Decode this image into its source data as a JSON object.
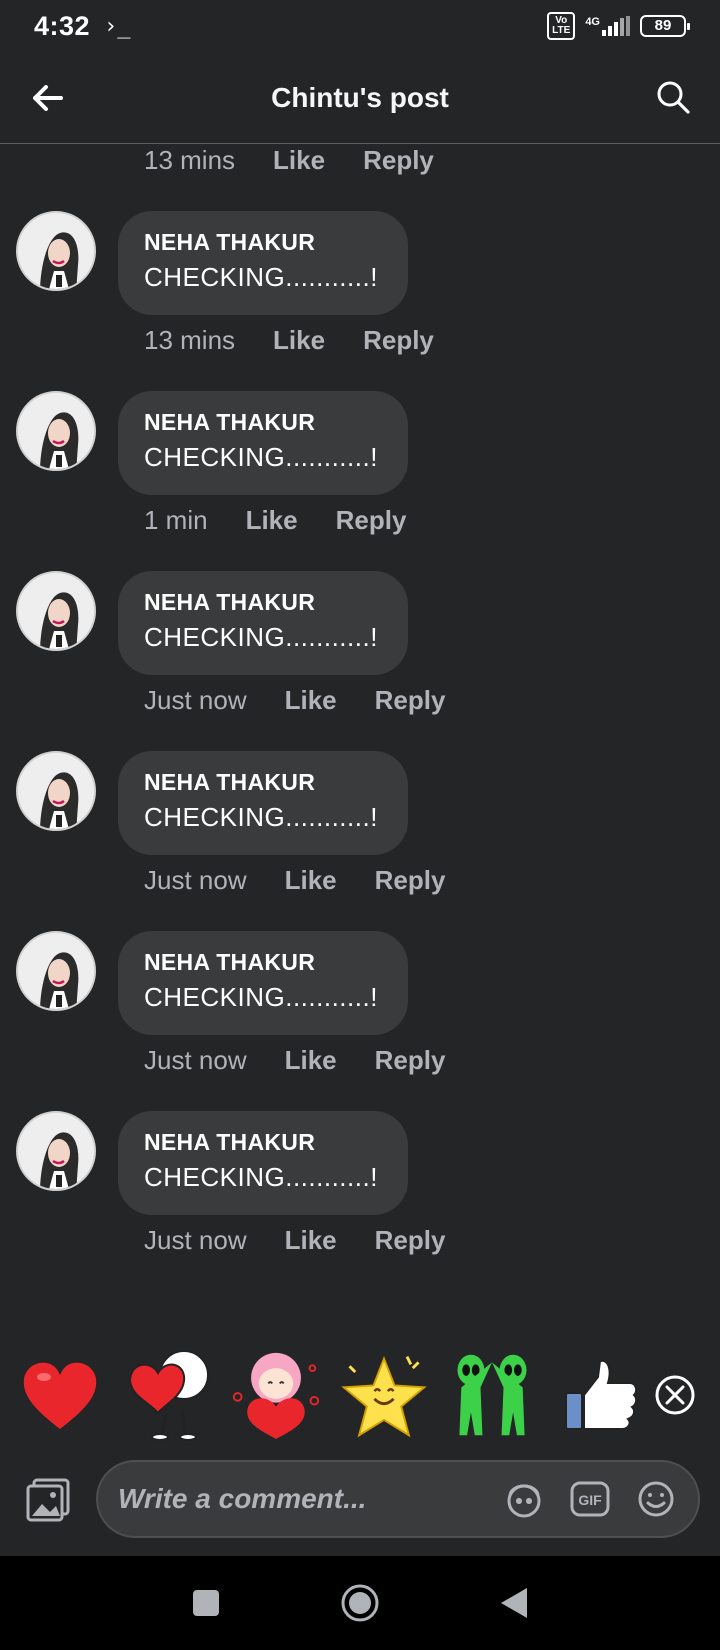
{
  "status_bar": {
    "time": "4:32",
    "terminal_glyph": "›_",
    "volte": "Vo LTE",
    "network": "4G",
    "battery": "89"
  },
  "header": {
    "title": "Chintu's post"
  },
  "top_meta": {
    "time": "13 mins",
    "like_label": "Like",
    "reply_label": "Reply"
  },
  "comments": [
    {
      "author": "NEHA THAKUR",
      "text": "CHECKING...........!",
      "time": "13 mins",
      "like_label": "Like",
      "reply_label": "Reply"
    },
    {
      "author": "NEHA THAKUR",
      "text": "CHECKING...........!",
      "time": "1 min",
      "like_label": "Like",
      "reply_label": "Reply"
    },
    {
      "author": "NEHA THAKUR",
      "text": "CHECKING...........!",
      "time": "Just now",
      "like_label": "Like",
      "reply_label": "Reply"
    },
    {
      "author": "NEHA THAKUR",
      "text": "CHECKING...........!",
      "time": "Just now",
      "like_label": "Like",
      "reply_label": "Reply"
    },
    {
      "author": "NEHA THAKUR",
      "text": "CHECKING...........!",
      "time": "Just now",
      "like_label": "Like",
      "reply_label": "Reply"
    },
    {
      "author": "NEHA THAKUR",
      "text": "CHECKING...........!",
      "time": "Just now",
      "like_label": "Like",
      "reply_label": "Reply"
    }
  ],
  "stickers": [
    "heart-sticker",
    "hugging-heart-sticker",
    "girl-heart-sticker",
    "smiling-star-sticker",
    "aliens-high-five-sticker",
    "thumbs-up-sticker"
  ],
  "composer": {
    "placeholder": "Write a comment...",
    "gif_label": "GIF"
  },
  "colors": {
    "background": "#242526",
    "bubble": "#3a3b3c",
    "secondary_text": "#b0b3b8",
    "primary_text": "#ffffff"
  }
}
